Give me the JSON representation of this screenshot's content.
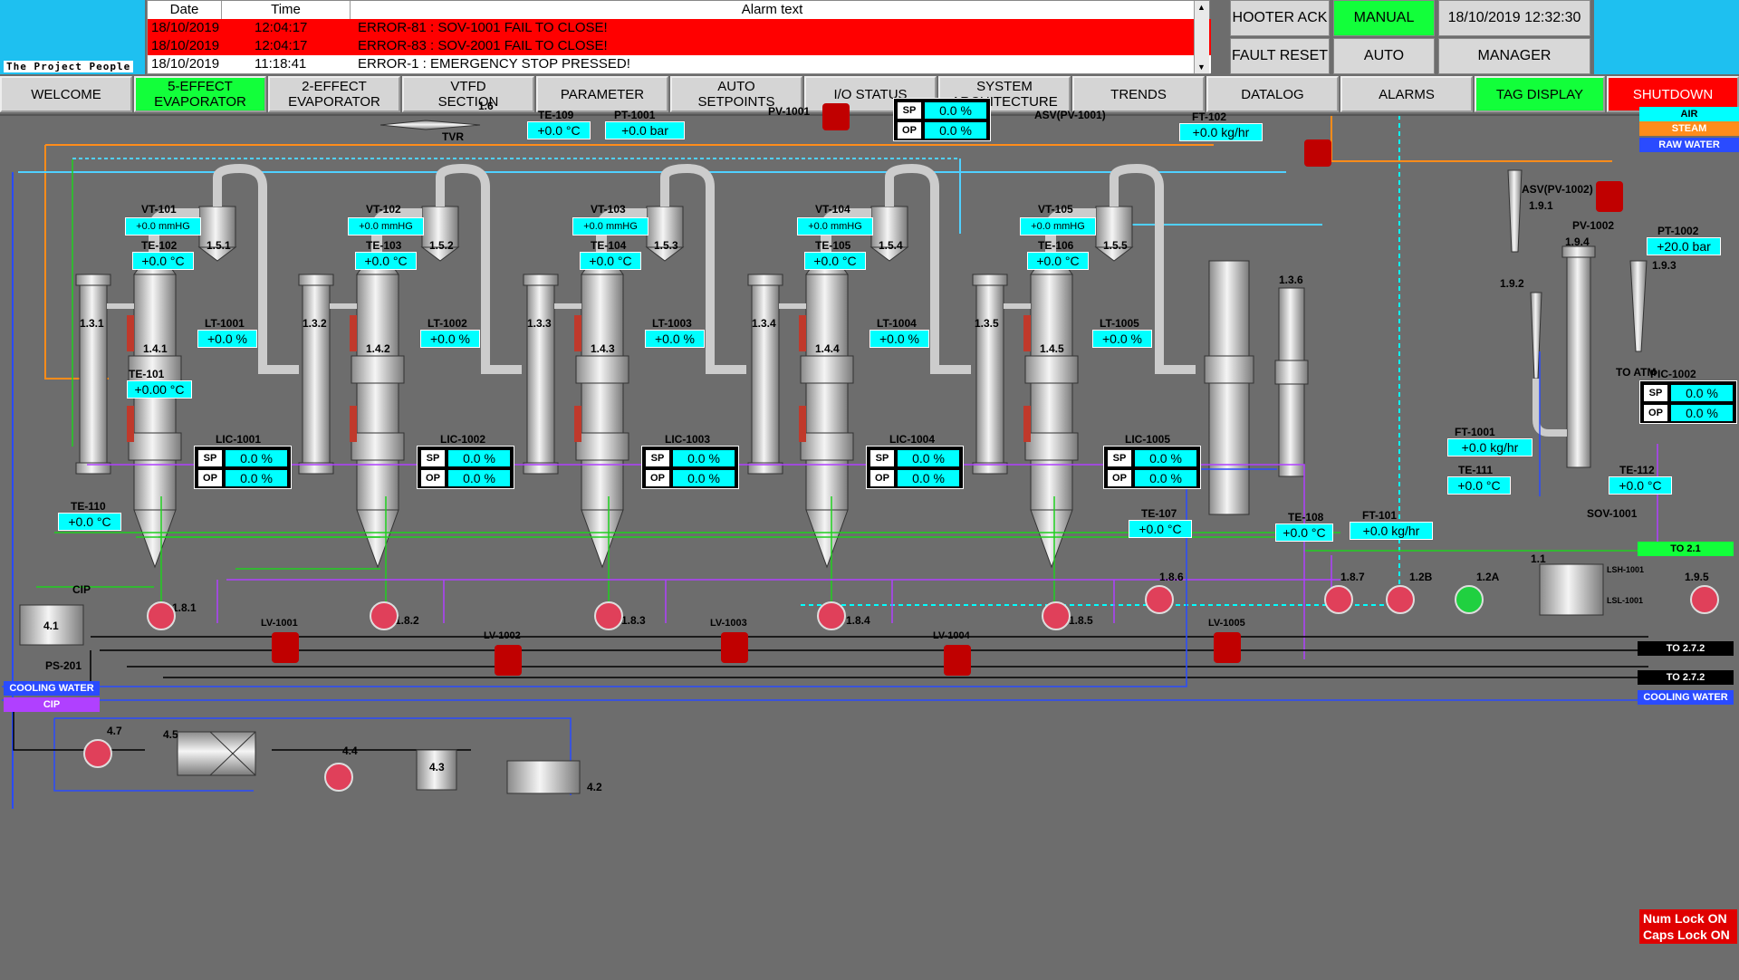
{
  "header": {
    "logo_text": "The Project People",
    "alarm_columns": [
      "Date",
      "Time",
      "Alarm text"
    ],
    "alarms": [
      {
        "date": "18/10/2019",
        "time": "12:04:17",
        "text": "ERROR-81 : SOV-1001 FAIL TO CLOSE!",
        "color": "#ff0000"
      },
      {
        "date": "18/10/2019",
        "time": "12:04:17",
        "text": "ERROR-83 : SOV-2001 FAIL TO CLOSE!",
        "color": "#ff0000"
      },
      {
        "date": "18/10/2019",
        "time": "11:18:41",
        "text": "ERROR-1 : EMERGENCY STOP PRESSED!",
        "color": "#ffffff"
      }
    ],
    "hooter_ack": "HOOTER ACK",
    "fault_reset": "FAULT RESET",
    "manual": "MANUAL",
    "auto": "AUTO",
    "datetime": "18/10/2019 12:32:30",
    "user": "MANAGER"
  },
  "nav": [
    {
      "label": "WELCOME",
      "state": "normal"
    },
    {
      "label": "5-EFFECT\nEVAPORATOR",
      "state": "active"
    },
    {
      "label": "2-EFFECT\nEVAPORATOR",
      "state": "normal"
    },
    {
      "label": "VTFD\nSECTION",
      "state": "normal"
    },
    {
      "label": "PARAMETER",
      "state": "normal"
    },
    {
      "label": "AUTO\nSETPOINTS",
      "state": "normal"
    },
    {
      "label": "I/O STATUS",
      "state": "normal"
    },
    {
      "label": "SYSTEM\nARCHITECTURE",
      "state": "normal"
    },
    {
      "label": "TRENDS",
      "state": "normal"
    },
    {
      "label": "DATALOG",
      "state": "normal"
    },
    {
      "label": "ALARMS",
      "state": "normal"
    },
    {
      "label": "TAG DISPLAY",
      "state": "active"
    },
    {
      "label": "SHUTDOWN",
      "state": "danger"
    }
  ],
  "colors": {
    "accent_green": "#12ff3a",
    "alarm_red": "#ff0000",
    "value_cyan": "#00ffff",
    "background": "#6d6d6d"
  },
  "top": {
    "te109": {
      "label": "TE-109",
      "value": "+0.0 °C"
    },
    "pt1001": {
      "label": "PT-1001",
      "value": "+0.0 bar"
    },
    "tvr_label": "TVR",
    "tvr_num": "1.6",
    "pv1001_label": "PV-1001",
    "pv1001_sp": "0.0 %",
    "pv1001_op": "0.0 %",
    "asv_pv1001": "ASV(PV-1001)",
    "ft102": {
      "label": "FT-102",
      "value": "+0.0 kg/hr"
    },
    "air": "AIR",
    "steam": "STEAM",
    "raw_water": "RAW WATER"
  },
  "effects": [
    {
      "vt": "VT-101",
      "vt_val": "+0.0 mmHG",
      "te": "TE-102",
      "te_val": "+0.0 °C",
      "sep": "1.5.1",
      "lt": "LT-1001",
      "lt_val": "+0.0 %",
      "col": "1.3.1",
      "body": "1.4.1",
      "lic": "LIC-1001",
      "sp": "0.0 %",
      "op": "0.0 %",
      "lv": "LV-1001",
      "pump": "1.8.1"
    },
    {
      "vt": "VT-102",
      "vt_val": "+0.0 mmHG",
      "te": "TE-103",
      "te_val": "+0.0 °C",
      "sep": "1.5.2",
      "lt": "LT-1002",
      "lt_val": "+0.0 %",
      "col": "1.3.2",
      "body": "1.4.2",
      "lic": "LIC-1002",
      "sp": "0.0 %",
      "op": "0.0 %",
      "lv": "LV-1002",
      "pump": "1.8.2"
    },
    {
      "vt": "VT-103",
      "vt_val": "+0.0 mmHG",
      "te": "TE-104",
      "te_val": "+0.0 °C",
      "sep": "1.5.3",
      "lt": "LT-1003",
      "lt_val": "+0.0 %",
      "col": "1.3.3",
      "body": "1.4.3",
      "lic": "LIC-1003",
      "sp": "0.0 %",
      "op": "0.0 %",
      "lv": "LV-1003",
      "pump": "1.8.3"
    },
    {
      "vt": "VT-104",
      "vt_val": "+0.0 mmHG",
      "te": "TE-105",
      "te_val": "+0.0 °C",
      "sep": "1.5.4",
      "lt": "LT-1004",
      "lt_val": "+0.0 %",
      "col": "1.3.4",
      "body": "1.4.4",
      "lic": "LIC-1004",
      "sp": "0.0 %",
      "op": "0.0 %",
      "lv": "LV-1004",
      "pump": "1.8.4"
    },
    {
      "vt": "VT-105",
      "vt_val": "+0.0 mmHG",
      "te": "TE-106",
      "te_val": "+0.0 °C",
      "sep": "1.5.5",
      "lt": "LT-1005",
      "lt_val": "+0.0 %",
      "col": "1.3.5",
      "body": "1.4.5",
      "lic": "LIC-1005",
      "sp": "0.0 %",
      "op": "0.0 %",
      "lv": "LV-1005",
      "pump": "1.8.5"
    }
  ],
  "misc": {
    "te101": {
      "label": "TE-101",
      "value": "+0.00 °C"
    },
    "te110": {
      "label": "TE-110",
      "value": "+0.0 °C"
    },
    "cip_label": "CIP",
    "te107": {
      "label": "TE-107",
      "value": "+0.0 °C"
    },
    "te108": {
      "label": "TE-108",
      "value": "+0.0 °C"
    },
    "ft101": {
      "label": "FT-101",
      "value": "+0.0 kg/hr"
    },
    "col136": "1.3.6",
    "pump186": "1.8.6",
    "pump187": "1.8.7",
    "pump128": "1.2B",
    "pump12a": "1.2A",
    "tank11": "1.1",
    "lsh": "LSH-1001",
    "lsl": "LSL-1001",
    "pump195": "1.9.5",
    "to21": "TO 2.1",
    "to272a": "TO 2.7.2",
    "to272b": "TO 2.7.2",
    "cooling_water_out": "COOLING WATER",
    "sov1001": "SOV-1001",
    "asv_pv1002": "ASV(PV-1002)",
    "n191": "1.9.1",
    "pv1002": "PV-1002",
    "pt1002": {
      "label": "PT-1002",
      "value": "+20.0 bar"
    },
    "n194": "1.9.4",
    "n193": "1.9.3",
    "n192": "1.9.2",
    "to_atm": "TO ATM",
    "pic1002": "PIC-1002",
    "pic_sp": "0.0 %",
    "pic_op": "0.0 %",
    "ft1001": {
      "label": "FT-1001",
      "value": "+0.0 kg/hr"
    },
    "te111": {
      "label": "TE-111",
      "value": "+0.0 °C"
    },
    "te112": {
      "label": "TE-112",
      "value": "+0.0 °C"
    }
  },
  "bottom": {
    "tank41": "4.1",
    "ps201": "PS-201",
    "cooling_water": "COOLING WATER",
    "cip": "CIP",
    "pump47": "4.7",
    "hx45": "4.5",
    "pump44": "4.4",
    "tank43": "4.3",
    "tank42": "4.2"
  },
  "status": {
    "num_lock": "Num Lock ON",
    "caps_lock": "Caps Lock ON"
  }
}
